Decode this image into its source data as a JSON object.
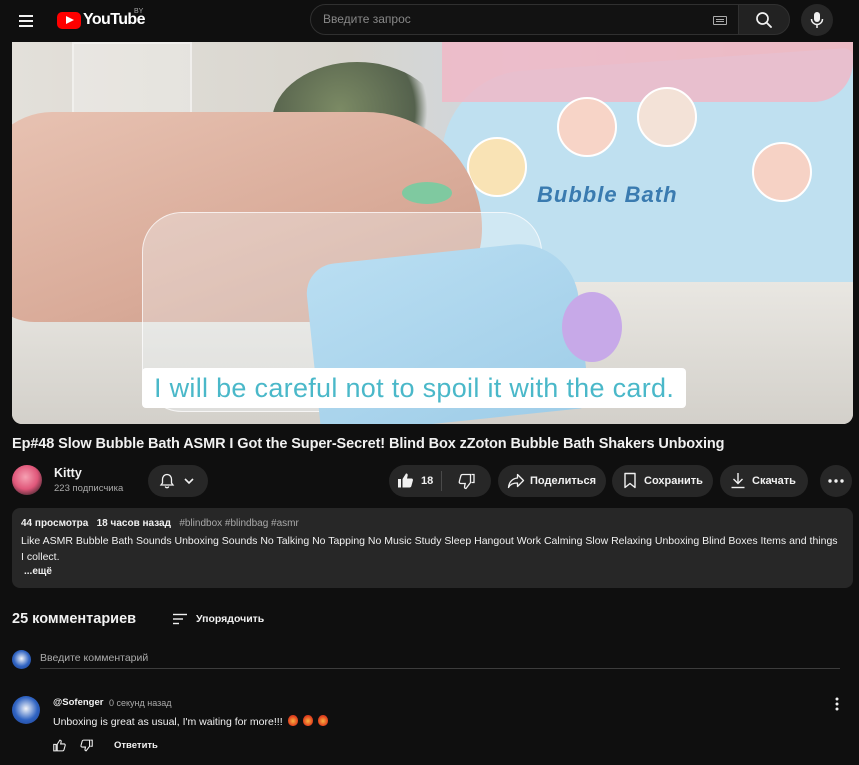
{
  "header": {
    "logo_text": "YouTube",
    "country_code": "BY",
    "search_placeholder": "Введите запрос"
  },
  "video": {
    "caption": "I will be careful not to spoil it with the card.",
    "box_label": "Bubble Bath",
    "title": "Ep#48 Slow Bubble Bath ASMR I Got the Super-Secret! Blind Box zZoton Bubble Bath Shakers Unboxing"
  },
  "channel": {
    "name": "Kitty",
    "subscribers": "223 подписчика"
  },
  "actions": {
    "like_count": "18",
    "share_label": "Поделиться",
    "save_label": "Сохранить",
    "download_label": "Скачать"
  },
  "description": {
    "views": "44 просмотра",
    "uploaded": "18 часов назад",
    "tags": "#blindbox #blindbag #asmr",
    "text": "Like ASMR Bubble Bath Sounds Unboxing Sounds No Talking No Tapping No Music Study Sleep Hangout Work Calming Slow Relaxing Unboxing Blind Boxes Items and things I collect.",
    "more_label": "...ещё"
  },
  "comments": {
    "count_label": "25 комментариев",
    "sort_label": "Упорядочить",
    "input_placeholder": "Введите комментарий",
    "items": [
      {
        "author": "@Sofenger",
        "time": "0 секунд назад",
        "text": "Unboxing is great as usual, I'm waiting for more!!!",
        "reply_label": "Ответить"
      }
    ]
  },
  "colors": {
    "background": "#0f0f0f",
    "surface": "#272727",
    "brand_red": "#ff0000",
    "caption_text": "#4ab8c9"
  },
  "icons": [
    "menu-icon",
    "youtube-logo-icon",
    "keyboard-icon",
    "search-icon",
    "mic-icon",
    "bell-icon",
    "chevron-down-icon",
    "like-icon",
    "dislike-icon",
    "share-icon",
    "save-icon",
    "download-icon",
    "more-icon",
    "sort-icon",
    "kebab-icon"
  ]
}
